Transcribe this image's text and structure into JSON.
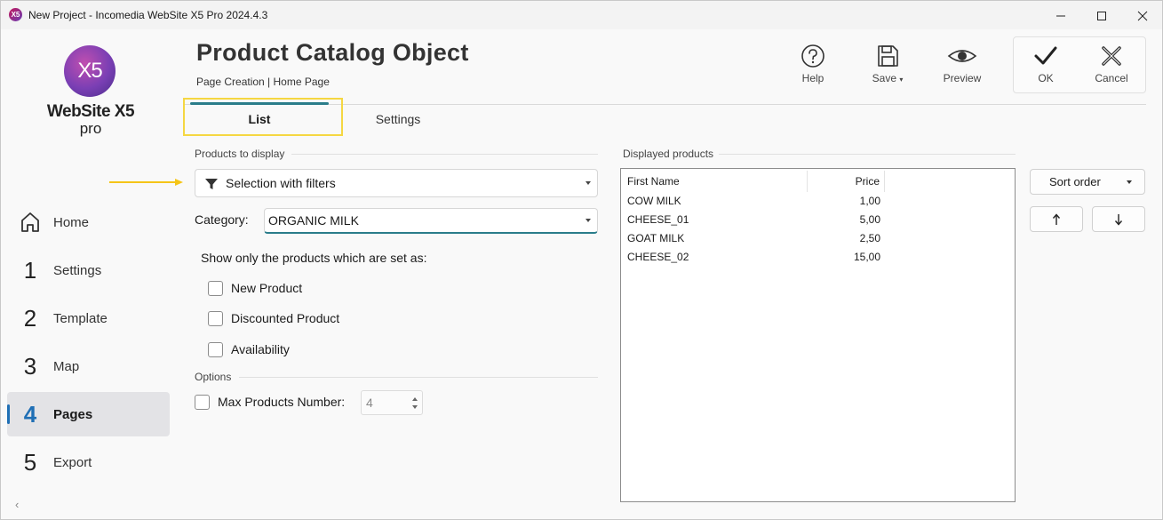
{
  "window": {
    "title": "New Project - Incomedia WebSite X5 Pro 2024.4.3",
    "app_icon": "X5"
  },
  "logo": {
    "mark": "X5",
    "name": "WebSite X5",
    "edition": "pro"
  },
  "sidebar": {
    "items": [
      {
        "num": "",
        "label": "Home",
        "icon": "home-icon"
      },
      {
        "num": "1",
        "label": "Settings"
      },
      {
        "num": "2",
        "label": "Template"
      },
      {
        "num": "3",
        "label": "Map"
      },
      {
        "num": "4",
        "label": "Pages",
        "active": true
      },
      {
        "num": "5",
        "label": "Export"
      }
    ],
    "collapse": "‹"
  },
  "header": {
    "title": "Product Catalog Object",
    "breadcrumb": "Page Creation | Home Page"
  },
  "toolbar": {
    "help": "Help",
    "save": "Save",
    "preview": "Preview",
    "ok": "OK",
    "cancel": "Cancel"
  },
  "tabs": {
    "list": "List",
    "settings": "Settings"
  },
  "products_to_display": {
    "section_label": "Products to display",
    "filter_value": "Selection with filters",
    "category_label": "Category:",
    "category_value": "ORGANIC MILK",
    "show_only_label": "Show only the products which are set as:",
    "checkboxes": [
      "New Product",
      "Discounted Product",
      "Availability"
    ]
  },
  "options": {
    "section_label": "Options",
    "max_label": "Max Products Number:",
    "max_value": "4"
  },
  "displayed_products": {
    "section_label": "Displayed products",
    "columns": [
      "First Name",
      "Price"
    ],
    "rows": [
      {
        "name": "COW MILK",
        "price": "1,00"
      },
      {
        "name": "CHEESE_01",
        "price": "5,00"
      },
      {
        "name": "GOAT MILK",
        "price": "2,50"
      },
      {
        "name": "CHEESE_02",
        "price": "15,00"
      }
    ]
  },
  "sort": {
    "label": "Sort order",
    "up": "↑",
    "down": "↓"
  },
  "colors": {
    "accent": "#2a7d8a",
    "highlight": "#f5d742",
    "active_nav": "#1f6fb5"
  }
}
